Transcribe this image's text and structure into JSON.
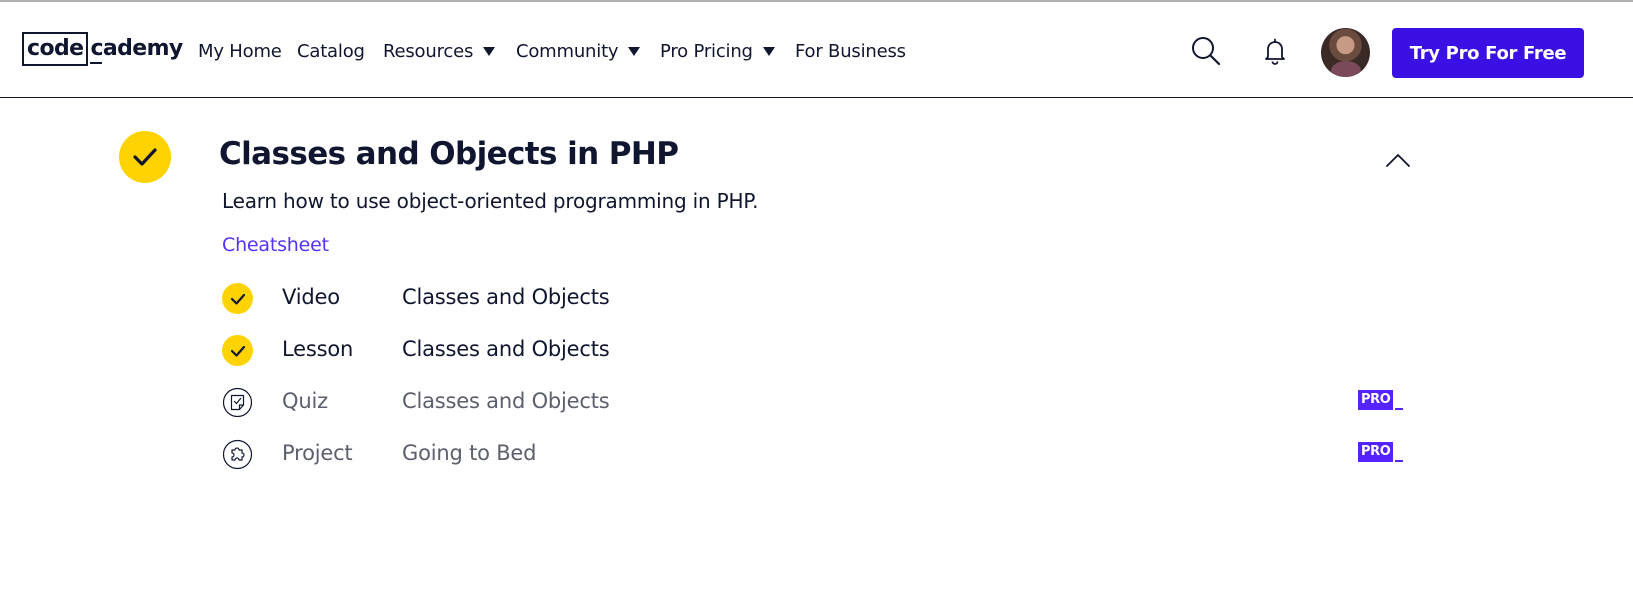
{
  "header": {
    "logo": {
      "boxed": "code",
      "rest": "cademy"
    },
    "nav": [
      {
        "label": "My Home",
        "dropdown": false
      },
      {
        "label": "Catalog",
        "dropdown": false
      },
      {
        "label": "Resources",
        "dropdown": true
      },
      {
        "label": "Community",
        "dropdown": true
      },
      {
        "label": "Pro Pricing",
        "dropdown": true
      },
      {
        "label": "For Business",
        "dropdown": false
      }
    ],
    "icons": {
      "search": "search-icon",
      "notifications": "bell-icon"
    },
    "cta_label": "Try Pro For Free"
  },
  "module": {
    "title": "Classes and Objects in PHP",
    "description": "Learn how to use object-oriented programming in PHP.",
    "cheatsheet_label": "Cheatsheet",
    "completed": true,
    "items": [
      {
        "type": "Video",
        "name": "Classes and Objects",
        "completed": true,
        "pro": false
      },
      {
        "type": "Lesson",
        "name": "Classes and Objects",
        "completed": true,
        "pro": false
      },
      {
        "type": "Quiz",
        "name": "Classes and Objects",
        "completed": false,
        "pro": true,
        "icon": "quiz-icon"
      },
      {
        "type": "Project",
        "name": "Going to Bed",
        "completed": false,
        "pro": true,
        "icon": "puzzle-icon"
      }
    ],
    "pro_badge_label": "PRO"
  },
  "colors": {
    "brand_blue": "#3a10e5",
    "check_yellow": "#ffd300",
    "navy": "#10162f",
    "link_purple": "#5533ff"
  }
}
